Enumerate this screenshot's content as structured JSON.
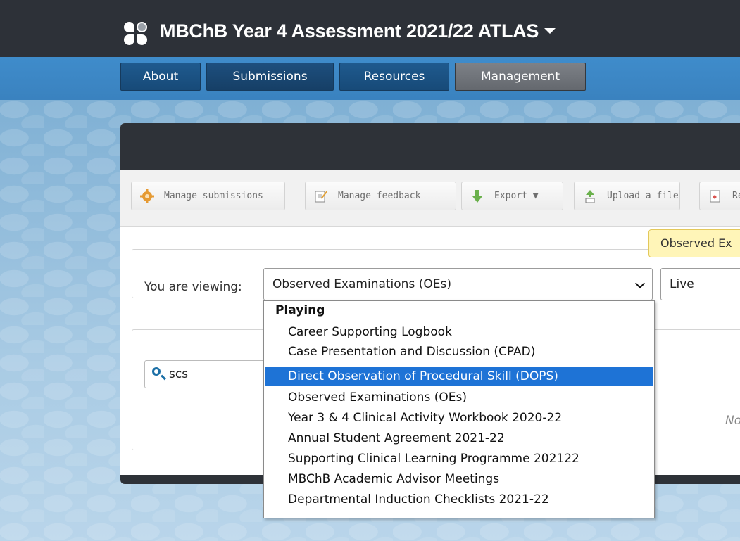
{
  "app": {
    "title": "MBChB Year 4 Assessment 2021/22 ATLAS",
    "logo_icon": "app-logo-icon"
  },
  "nav": {
    "tabs": [
      {
        "label": "About",
        "selected": false
      },
      {
        "label": "Submissions",
        "selected": true
      },
      {
        "label": "Resources",
        "selected": false
      },
      {
        "label": "Management",
        "selected": false
      }
    ]
  },
  "toolbar": {
    "buttons": [
      {
        "label": "Manage submissions",
        "icon": "gear-icon"
      },
      {
        "label": "Manage feedback",
        "icon": "feedback-icon"
      },
      {
        "label": "Export ▼",
        "icon": "export-arrow-icon"
      },
      {
        "label": "Upload a file",
        "icon": "upload-icon"
      },
      {
        "label": "Re",
        "icon": "report-icon"
      }
    ]
  },
  "tooltip": {
    "text": "Observed Ex"
  },
  "viewing": {
    "label": "You are viewing:",
    "selected": "Observed Examinations (OEs)",
    "status": "Live"
  },
  "search": {
    "value": "scs"
  },
  "results": {
    "partial_text": "No"
  },
  "dropdown": {
    "group": "Playing",
    "options": [
      "Career Supporting Logbook",
      "Case Presentation and Discussion (CPAD)",
      "Direct Observation of Procedural Skill (DOPS)",
      "Observed Examinations (OEs)",
      "Year 3 & 4 Clinical Activity Workbook 2020-22",
      "Annual Student Agreement 2021-22",
      "Supporting Clinical Learning Programme 202122",
      "MBChB Academic Advisor Meetings",
      "Departmental Induction Checklists 2021-22"
    ],
    "highlighted": "Direct Observation of Procedural Skill (DOPS)"
  },
  "colors": {
    "topbar": "#2d3138",
    "navbar": "#3b86c3",
    "highlight": "#1e73d6",
    "tooltip": "#fff5b8"
  }
}
